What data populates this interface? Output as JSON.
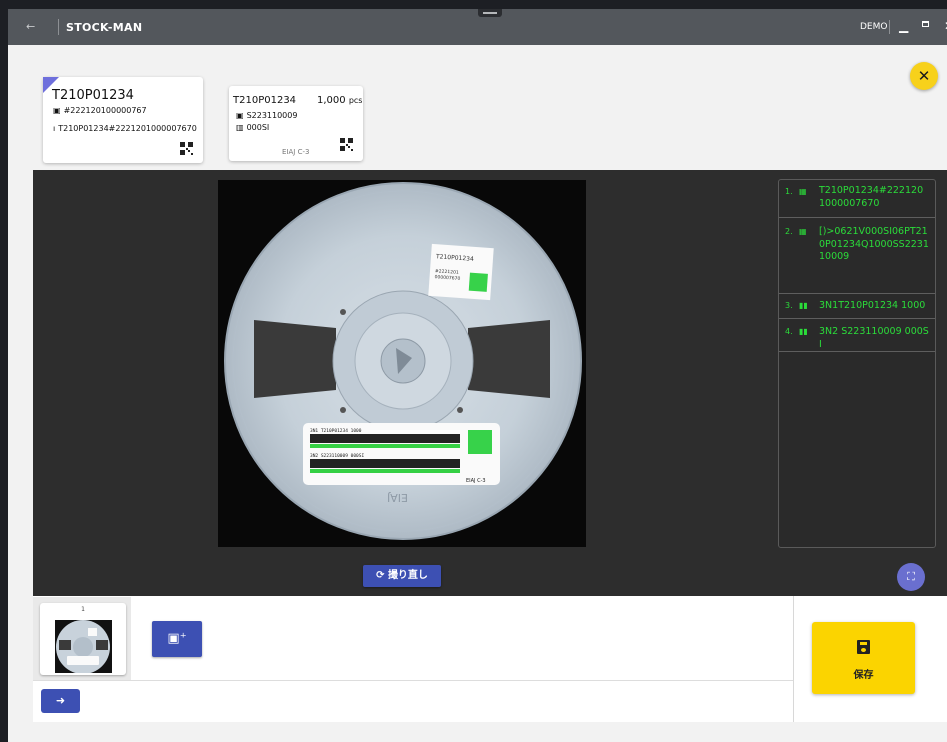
{
  "titlebar": {
    "back_icon": "arrow-left-icon",
    "title": "STOCK-MAN",
    "user": "DEMO",
    "min_label": "▁",
    "close_label": "✕"
  },
  "card_primary": {
    "part_no": "T210P01234",
    "id_line": "#222120100000767",
    "scan_line": "T210P01234#2221201000007670"
  },
  "card_secondary": {
    "part_no": "T210P01234",
    "qty": "1,000",
    "qty_unit": "pcs",
    "line1": "S223110009",
    "line2": "000SI",
    "format": "EIAJ C-3"
  },
  "scan_results": [
    {
      "num": "1.",
      "type": "qr",
      "text": "T210P01234#2221201000007670"
    },
    {
      "num": "2.",
      "type": "qr",
      "text": "[)>0621V000SI06PT210P01234Q1000SS223110009"
    },
    {
      "num": "3.",
      "type": "barcode",
      "text": "3N1T210P01234 1000"
    },
    {
      "num": "4.",
      "type": "barcode",
      "text": "3N2 S223110009 000SI"
    }
  ],
  "photo_label": {
    "top_title": "T210P01234",
    "top_lines": [
      "#2221201",
      "000007670"
    ],
    "big_line1": "3N1 T210P01234 1000",
    "big_line2": "3N2 S223110009 000SI",
    "big_foot": "EIAJ C-3",
    "reel_rim_text": "EIAJ"
  },
  "retake_label": "撮り直し",
  "thumbnail_index": "1",
  "save_label": "保存",
  "colors": {
    "accent_blue": "#3d50b3",
    "accent_yellow": "#fbd400",
    "scan_green": "#2bdc3a"
  }
}
